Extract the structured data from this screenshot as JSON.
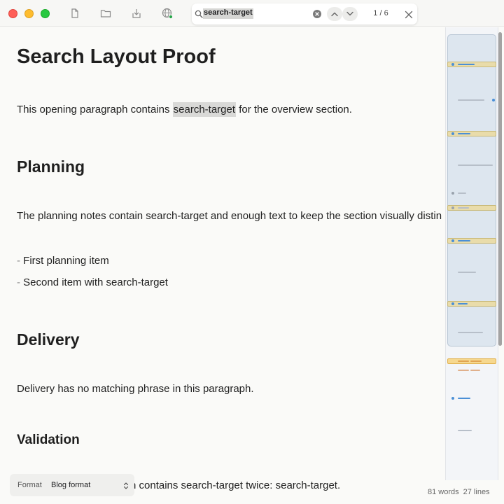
{
  "window": {
    "traffic_lights": {
      "close": "#fe5f57",
      "minimize": "#febc2e",
      "maximize": "#28c840"
    }
  },
  "toolbar": {
    "icons": [
      "new-document-icon",
      "folder-icon",
      "download-icon",
      "globe-icon"
    ],
    "status_dot_color": "#27a64a"
  },
  "find": {
    "query": "search-target",
    "match_count": "1 / 6"
  },
  "document": {
    "title": "Search Layout Proof",
    "intro_before": "This opening paragraph contains ",
    "intro_match": "search-target",
    "intro_after": " for the overview section.",
    "planning_heading": "Planning",
    "planning_text": "The planning notes contain search-target and enough text to keep the section visually distin",
    "bullet_dash": "-",
    "bullet_1": "First planning item",
    "bullet_2": "Second item with search-target",
    "delivery_heading": "Delivery",
    "delivery_text": "Delivery has no matching phrase in this paragraph.",
    "validation_heading": "Validation",
    "validation_text_visible": "n contains search-target twice: search-target."
  },
  "footer": {
    "format_label": "Format",
    "format_value": "Blog format",
    "words": "81 words",
    "lines": "27 lines"
  },
  "colors": {
    "highlight_match": "#d9d9d7",
    "minimap_viewport": "#dde6ef",
    "minimap_hit": "#e9dcaa",
    "minimap_current_hit": "#f6d88f",
    "accent_blue": "#4a8fd6"
  }
}
